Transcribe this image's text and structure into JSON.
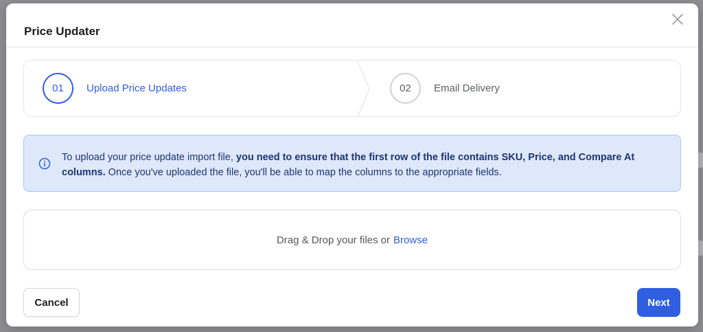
{
  "modal": {
    "title": "Price Updater"
  },
  "stepper": {
    "steps": [
      {
        "number": "01",
        "label": "Upload Price Updates",
        "state": "active"
      },
      {
        "number": "02",
        "label": "Email Delivery",
        "state": "inactive"
      }
    ]
  },
  "info": {
    "icon": "info-circle-icon",
    "text_pre": "To upload your price update import file, ",
    "text_bold": "you need to ensure that the first row of the file contains SKU, Price, and Compare At columns.",
    "text_post": " Once you've uploaded the file, you'll be able to map the columns to the appropriate fields."
  },
  "dropzone": {
    "text": "Drag & Drop your files or",
    "browse_label": "Browse"
  },
  "footer": {
    "cancel_label": "Cancel",
    "next_label": "Next"
  },
  "colors": {
    "accent": "#2f5fe0",
    "info_bg": "#dde8fb",
    "info_border": "#a9c5f5",
    "info_text": "#1e3470"
  }
}
